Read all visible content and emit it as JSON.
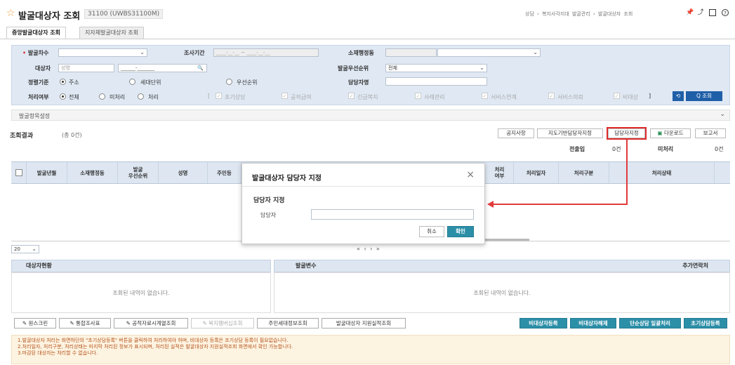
{
  "header": {
    "title": "발굴대상자 조회",
    "code": "31100",
    "code_sub": "(UWBS31100M)",
    "breadcrumb": "상담  ›  복지사각지대 발굴관리  ›  발굴대상자 조회"
  },
  "tabs": [
    "중앙발굴대상자 조회",
    "지자체발굴대상자 조회"
  ],
  "search": {
    "round_label": "발굴차수",
    "period_label": "조사기간",
    "period_value": "____-__-__ ~ ____-__-__",
    "jurisdiction_label": "소재행정동",
    "target_label": "대상자",
    "target_placeholder": "성명",
    "target_rrn": "______-_______",
    "priority_label": "발굴우선순위",
    "priority_value": "전체",
    "sort_label": "정렬기준",
    "sort_options": [
      "주소",
      "세대단위",
      "우선순위"
    ],
    "manager_label": "담당자명",
    "status_label": "처리여부",
    "status_options": [
      "전체",
      "미처리",
      "처리"
    ],
    "checks": [
      "초기상담",
      "공적급여",
      "긴급복지",
      "사례관리",
      "서비스연계",
      "서비스의뢰",
      "비대상"
    ],
    "bracket_open": "[",
    "bracket_close": "]",
    "reset_icon": "⟲",
    "search_label": "Q 조회"
  },
  "reg_section": "발굴항목설정",
  "result": {
    "title": "조회결과",
    "count": "(총 0건)",
    "buttons": [
      "공지사항",
      "지도기반담당자지정",
      "담당자지정",
      "다운로드",
      "보고서"
    ],
    "transfer_label": "전출입",
    "transfer_value": "0건",
    "unproc_label": "미처리",
    "unproc_value": "0건"
  },
  "grid": {
    "headers": [
      "발굴년월",
      "소재행정동",
      "발굴\n우선순위",
      "성명",
      "주민등",
      "처리\n여부",
      "처리일자",
      "처리구분",
      "처리상태"
    ]
  },
  "pager": {
    "size": "20",
    "nav": "«  ‹      ›  »"
  },
  "lower": {
    "left_title": "대상자현황",
    "mid_title": "발굴변수",
    "right_title": "추가연락처",
    "empty": "조회된 내역이 없습니다."
  },
  "bottom_buttons": [
    "원스크린",
    "통합조사표",
    "공적자료시계열조회",
    "복지멤버십조회",
    "주민세대정보조회",
    "발굴대상자 지원실적조회"
  ],
  "bottom_teal": [
    "비대상자등록",
    "비대상자해제",
    "단순상담 일괄처리",
    "초기상담등록"
  ],
  "notes": [
    "1.발굴대상자 처리는 화면하단의 \"초기상담등록\" 버튼을 클릭하여 처리하여야 하며, 비대상자 등록은 조기상담 등록이 필요없습니다.",
    "2.처리일자, 처리구분, 처리상태는 마지막 처리된 정보가 표시되며, 처리된 실적은 발굴대상자 지원실적조회 화면에서 확인 가능합니다.",
    "3.마감된 대상자는 처리할 수 없습니다."
  ],
  "modal": {
    "title": "발굴대상자 담당자 지정",
    "section": "담당자 지정",
    "field_label": "담당자",
    "cancel": "취소",
    "ok": "확인",
    "close": "×"
  },
  "colors": {
    "accent": "#1f5fa8",
    "teal": "#2c8fa8",
    "highlight": "#e02b2b"
  }
}
